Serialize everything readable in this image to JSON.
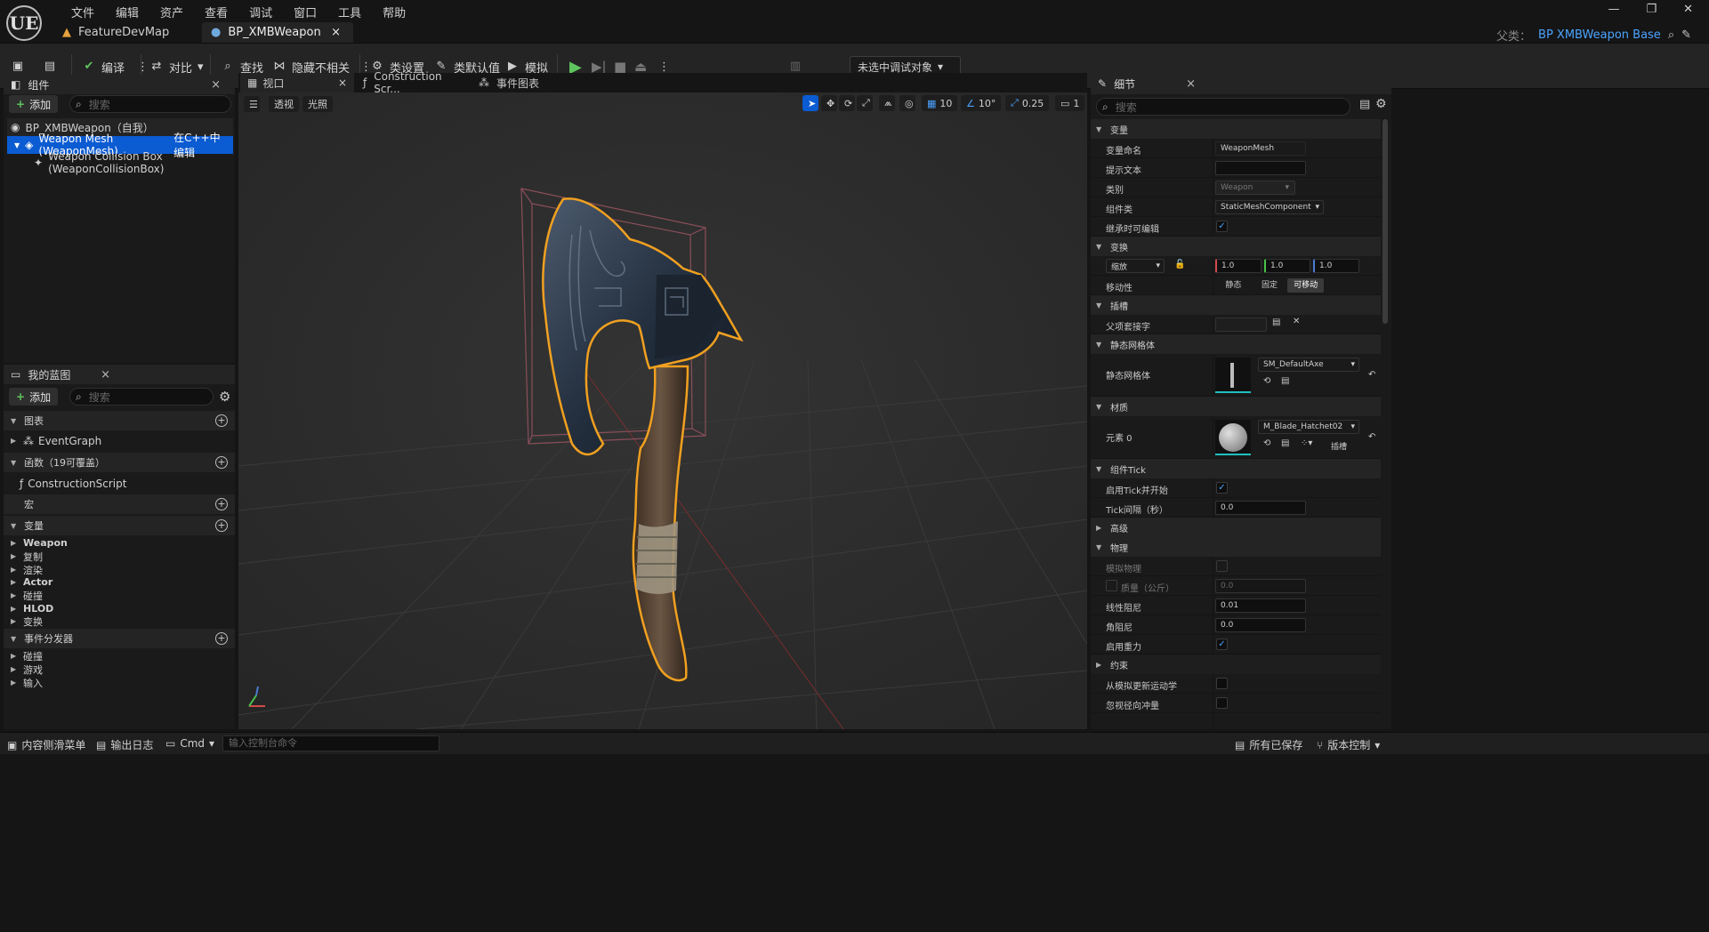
{
  "app": {
    "logo": "UE",
    "menu": [
      "文件",
      "编辑",
      "资产",
      "查看",
      "调试",
      "窗口",
      "工具",
      "帮助"
    ],
    "tabs": [
      {
        "label": "FeatureDevMap",
        "icon": "map-icon"
      },
      {
        "label": "BP_XMBWeapon",
        "icon": "blueprint-icon",
        "close": "×"
      }
    ],
    "window_controls": [
      "—",
      "❐",
      "✕"
    ],
    "parent_class": {
      "label": "父类：",
      "value": "BP XMBWeapon Base"
    }
  },
  "toolbar": {
    "compile": "编译",
    "diff": "对比",
    "find": "查找",
    "hide_unrelated": "隐藏不相关",
    "class_settings": "类设置",
    "class_defaults": "类默认值",
    "simulate": "模拟",
    "debug_target": "未选中调试对象"
  },
  "components_panel": {
    "title": "组件",
    "add": "添加",
    "search_placeholder": "搜索",
    "tree": [
      {
        "label": "BP_XMBWeapon（自我）"
      },
      {
        "label": "Weapon Mesh (WeaponMesh)",
        "action": "在C++中编辑"
      },
      {
        "label": "Weapon Collision Box (WeaponCollisionBox)"
      }
    ]
  },
  "my_blueprint": {
    "title": "我的蓝图",
    "add": "添加",
    "search_placeholder": "搜索",
    "graphs": "图表",
    "event_graph": "EventGraph",
    "functions": "函数（19可覆盖）",
    "construction_script": "ConstructionScript",
    "macros": "宏",
    "variables": "变量",
    "variable_categories": [
      "Weapon",
      "复制",
      "渲染",
      "Actor",
      "碰撞",
      "HLOD",
      "变换"
    ],
    "event_dispatchers": "事件分发器",
    "dispatcher_categories": [
      "碰撞",
      "游戏",
      "输入"
    ]
  },
  "center_tabs": {
    "viewport": "视口",
    "construction": "Construction Scr...",
    "event_graph": "事件图表"
  },
  "viewport": {
    "perspective": "透视",
    "lit": "光照",
    "grid_snap": "10",
    "rot_snap": "10°",
    "scale_snap": "0.25",
    "camera_speed": "1"
  },
  "details": {
    "title": "细节",
    "search_placeholder": "搜索",
    "sections": {
      "variable": "变量",
      "transform": "变换",
      "sockets": "插槽",
      "static_mesh": "静态网格体",
      "materials": "材质",
      "tick": "组件Tick",
      "advanced": "高级",
      "physics": "物理",
      "constraints": "约束"
    },
    "variable_name_label": "变量命名",
    "variable_name": "WeaponMesh",
    "tooltip_label": "提示文本",
    "tooltip": "",
    "category_label": "类别",
    "category": "Weapon",
    "component_class_label": "组件类",
    "component_class": "StaticMeshComponent",
    "editable_inherit_label": "继承时可编辑",
    "scale_label": "缩放",
    "scale": [
      "1.0",
      "1.0",
      "1.0"
    ],
    "mobility_label": "移动性",
    "mobility": [
      "静态",
      "固定",
      "可移动"
    ],
    "parent_socket_label": "父项套接字",
    "static_mesh_label": "静态网格体",
    "static_mesh": "SM_DefaultAxe",
    "element_label": "元素 0",
    "material": "M_Blade_Hatchet02",
    "slot_label": "插槽",
    "start_tick_label": "启用Tick并开始",
    "tick_interval_label": "Tick间隔（秒）",
    "tick_interval": "0.0",
    "simulate_physics_label": "模拟物理",
    "mass_label": "质量（公斤）",
    "mass": "0.0",
    "linear_damping_label": "线性阻尼",
    "linear_damping": "0.01",
    "angular_damping_label": "角阻尼",
    "angular_damping": "0.0",
    "gravity_label": "启用重力",
    "update_kinematic_label": "从模拟更新运动学",
    "ignore_radial_label": "忽视径向冲量"
  },
  "statusbar": {
    "content_drawer": "内容侧滑菜单",
    "output_log": "输出日志",
    "cmd": "Cmd",
    "console_placeholder": "输入控制台命令",
    "all_saved": "所有已保存",
    "source_control": "版本控制"
  }
}
